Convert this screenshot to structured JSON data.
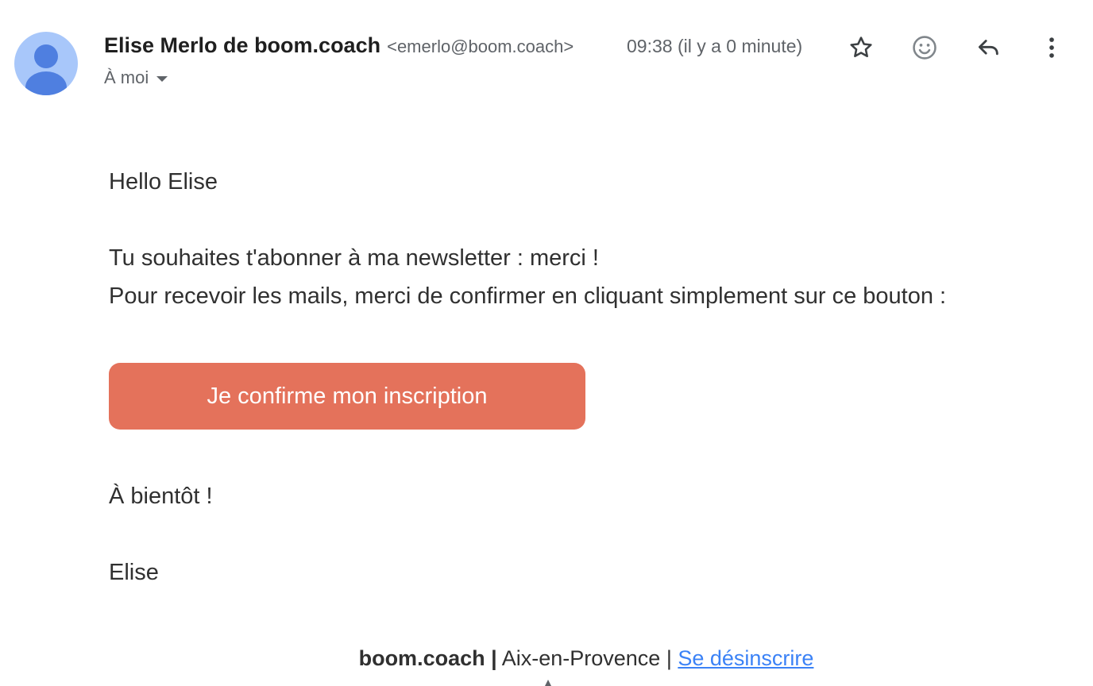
{
  "header": {
    "sender_name": "Elise Merlo de boom.coach",
    "sender_email": "<emerlo@boom.coach>",
    "timestamp": "09:38 (il y a 0 minute)",
    "recipient": "À moi",
    "icons": [
      "avatar-icon",
      "star-icon",
      "emoji-icon",
      "reply-icon",
      "more-vert-icon",
      "chevron-down-icon"
    ]
  },
  "body": {
    "greeting": "Hello Elise",
    "line1": "Tu souhaites t'abonner à ma newsletter : merci !",
    "line2": "Pour recevoir les mails, merci de confirmer en cliquant simplement sur ce bouton :",
    "cta_label": "Je confirme mon inscription",
    "closing": "À bientôt !",
    "signature": "Elise"
  },
  "footer": {
    "brand": "boom.coach",
    "separator": "|",
    "city": "Aix-en-Provence",
    "unsubscribe": "Se désinscrire"
  },
  "colors": {
    "cta_background": "#e4725b",
    "link": "#3b82f6",
    "avatar_background": "#a8c7fa",
    "avatar_figure": "#4f7fe0"
  }
}
